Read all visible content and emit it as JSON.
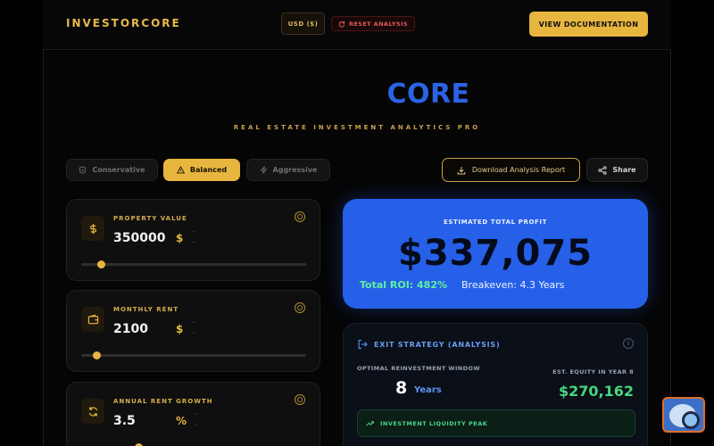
{
  "header": {
    "brand": "INVESTORCORE",
    "currency_label": "USD ($)",
    "reset_label": "RESET ANALYSIS",
    "docs_label": "VIEW DOCUMENTATION"
  },
  "hero": {
    "title": "CORE",
    "subtitle": "REAL ESTATE INVESTMENT ANALYTICS PRO"
  },
  "strategies": {
    "options": [
      "Conservative",
      "Balanced",
      "Aggressive"
    ],
    "selected": "Balanced"
  },
  "actions": {
    "download_label": "Download Analysis Report",
    "share_label": "Share"
  },
  "inputs": [
    {
      "label": "PROPERTY VALUE",
      "value": "350000",
      "unit": "$",
      "icon": "dollar-icon",
      "slider_fraction": 0.07
    },
    {
      "label": "MONTHLY RENT",
      "value": "2100",
      "unit": "$",
      "icon": "wallet-icon",
      "slider_fraction": 0.05
    },
    {
      "label": "ANNUAL RENT GROWTH",
      "value": "3.5",
      "unit": "%",
      "icon": "refresh-icon",
      "slider_fraction": 0.24
    }
  ],
  "profit": {
    "label": "ESTIMATED TOTAL PROFIT",
    "value": "$337,075",
    "roi": "Total ROI: 482%",
    "breakeven": "Breakeven: 4.3 Years"
  },
  "exit_strategy": {
    "title": "EXIT STRATEGY (ANALYSIS)",
    "window_label": "OPTIMAL REINVESTMENT WINDOW",
    "window_value": "8",
    "window_unit": "Years",
    "equity_label": "EST. EQUITY IN YEAR 8",
    "equity_value": "$270,162",
    "peak_label": "INVESTMENT LIQUIDITY PEAK"
  },
  "colors": {
    "accent_gold": "#e7b63f",
    "primary_blue": "#2660e8",
    "positive_green": "#47d67e",
    "danger_red": "#e25b5b"
  }
}
